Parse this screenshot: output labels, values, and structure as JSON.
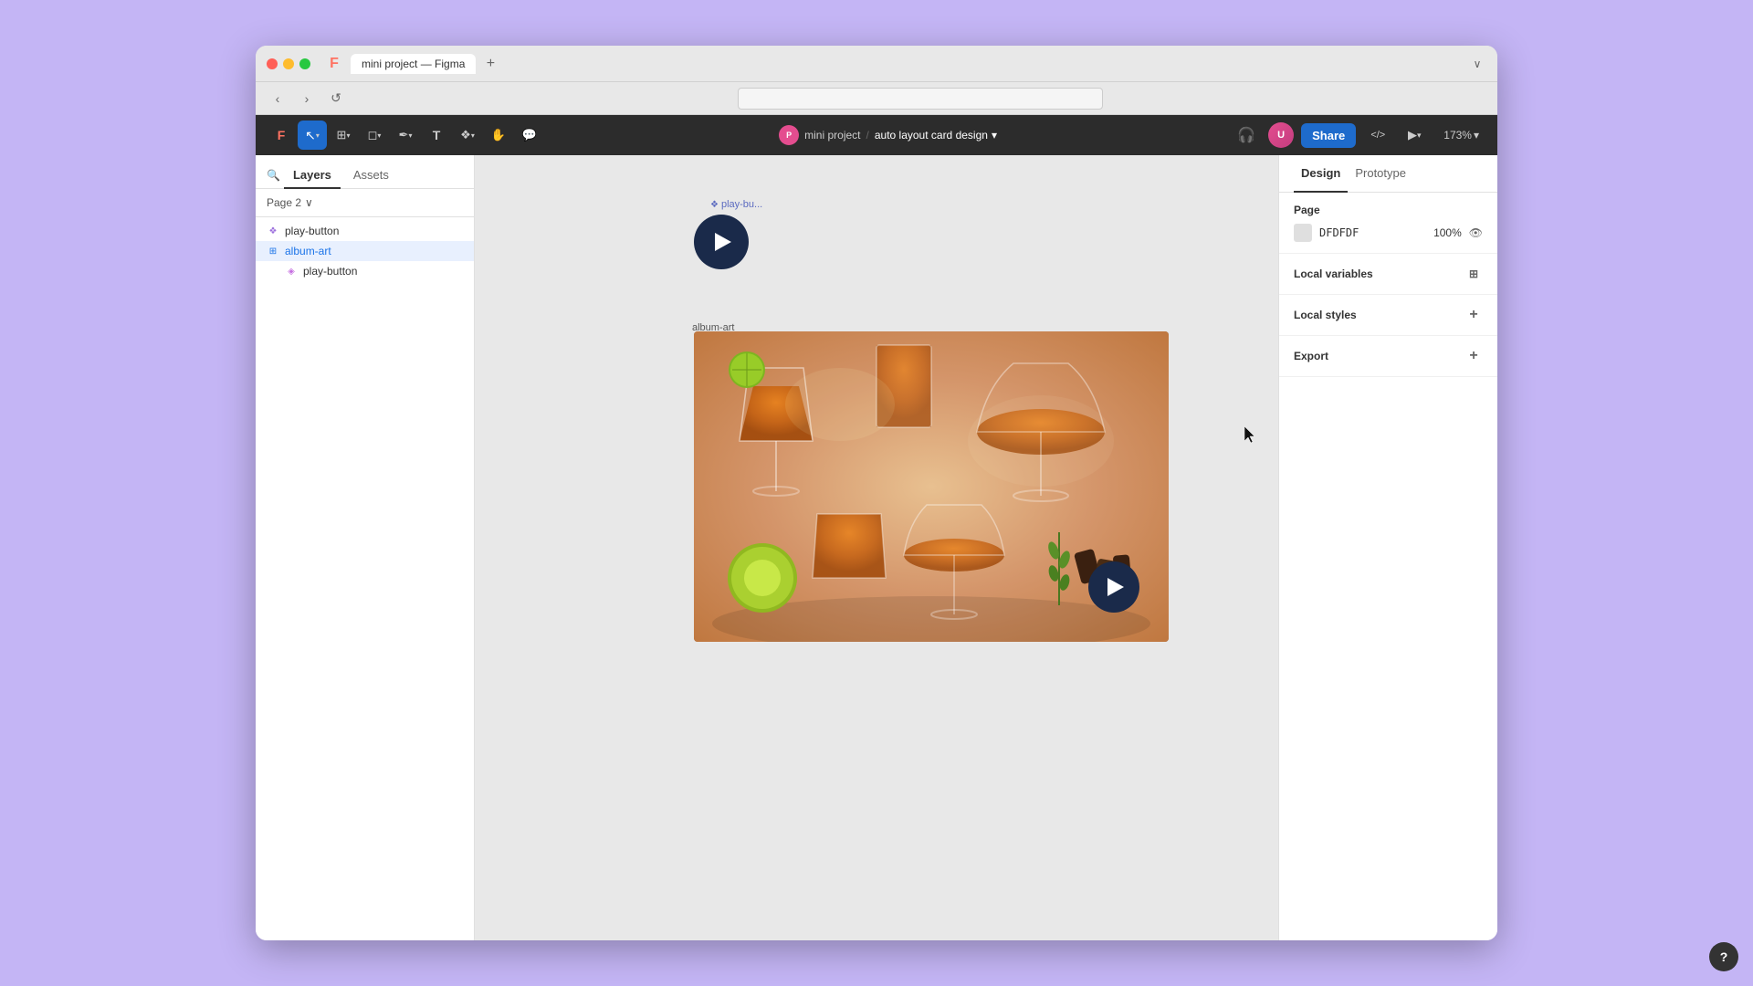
{
  "browser": {
    "tab_title": "mini project — Figma",
    "new_tab_label": "+",
    "collapse_label": "∨"
  },
  "address_bar": {
    "back": "‹",
    "forward": "›",
    "refresh": "↺",
    "url": ""
  },
  "toolbar": {
    "project_name": "mini project",
    "separator": "/",
    "design_name": "auto layout card design",
    "share_label": "Share",
    "zoom_level": "173%",
    "play_label": "▶",
    "chevron_down": "▾"
  },
  "left_sidebar": {
    "tabs": [
      {
        "id": "layers",
        "label": "Layers",
        "active": true
      },
      {
        "id": "assets",
        "label": "Assets",
        "active": false
      }
    ],
    "page_selector": {
      "label": "Page 2",
      "chevron": "∨"
    },
    "layers": [
      {
        "id": "play-button-layer",
        "name": "play-button",
        "icon": "component",
        "level": 0,
        "selected": false
      },
      {
        "id": "album-art-layer",
        "name": "album-art",
        "icon": "frame",
        "level": 0,
        "selected": true
      },
      {
        "id": "play-button-child",
        "name": "play-button",
        "icon": "component-instance",
        "level": 1,
        "selected": false
      }
    ]
  },
  "canvas": {
    "play_button_label": "play-bu...",
    "album_art_label": "album-art",
    "play_icon_symbol": "▶"
  },
  "right_sidebar": {
    "tabs": [
      {
        "id": "design",
        "label": "Design",
        "active": true
      },
      {
        "id": "prototype",
        "label": "Prototype",
        "active": false
      }
    ],
    "page_section": {
      "title": "Page",
      "color_label": "DFDFDF",
      "opacity": "100%"
    },
    "local_variables": {
      "title": "Local variables",
      "icon": "sliders"
    },
    "local_styles": {
      "title": "Local styles",
      "add_icon": "+"
    },
    "export": {
      "title": "Export",
      "add_icon": "+"
    }
  },
  "help_button": {
    "label": "?"
  },
  "icons": {
    "move_tool": "↖",
    "frame_tool": "⬜",
    "shape_tool": "◻",
    "pen_tool": "✒",
    "text_tool": "T",
    "component_tool": "❖",
    "hand_tool": "✋",
    "comment_tool": "💬",
    "headphones": "🎧",
    "code_icon": "</>",
    "play_btn_icon": "▶"
  }
}
